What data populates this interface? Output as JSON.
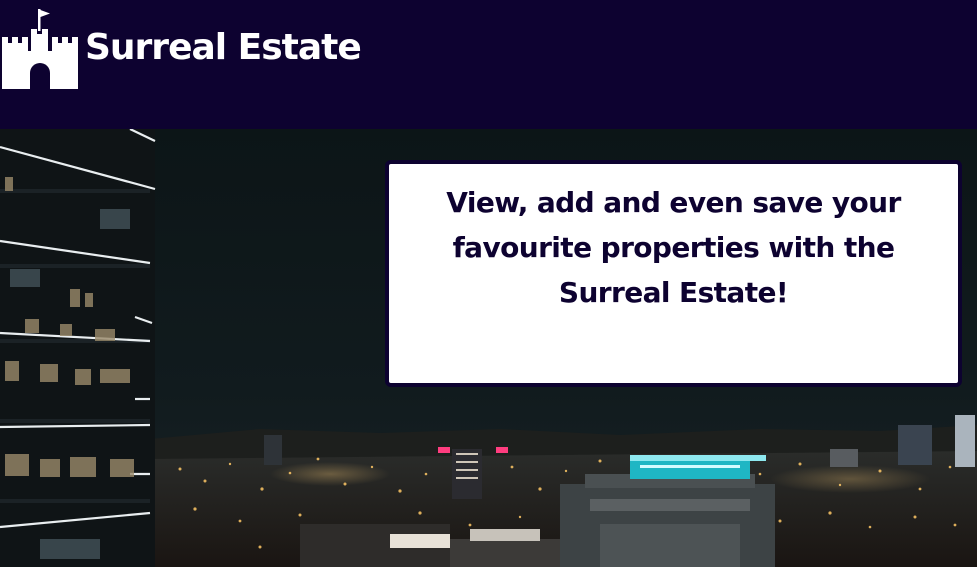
{
  "header": {
    "brand_name": "Surreal Estate",
    "logo_icon": "castle-icon",
    "background_color": "#0d0230"
  },
  "hero": {
    "image": "night-city-skyline",
    "tagline": "View, add and even save your favourite properties with the Surreal Estate!"
  },
  "colors": {
    "primary": "#0d0230",
    "card_background": "#ffffff",
    "text_light": "#ffffff"
  }
}
